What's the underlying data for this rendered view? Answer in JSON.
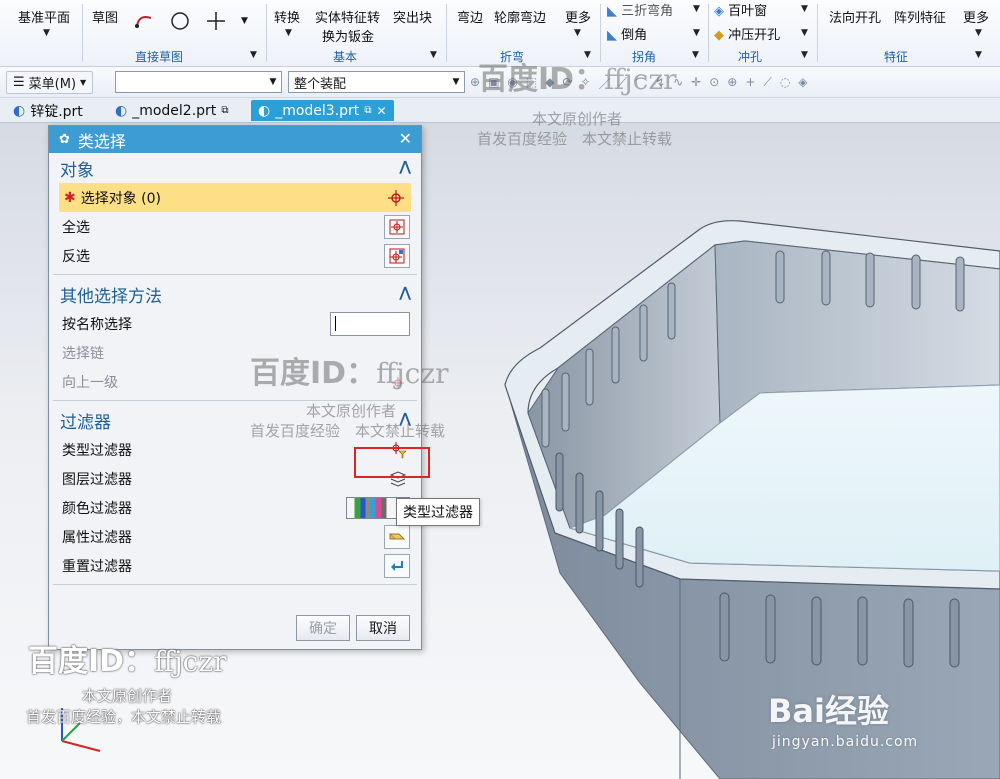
{
  "ribbon": {
    "datum_plane": "基准平面",
    "sketch": "草图",
    "convert": "转换",
    "solid_to_sheet_line1": "实体特征转",
    "solid_to_sheet_line2": "换为钣金",
    "protrude": "突出块",
    "flange": "弯边",
    "contour_flange": "轮廓弯边",
    "more1": "更多",
    "tri_bend": "三折弯角",
    "chamfer": "倒角",
    "louver": "百叶窗",
    "punch_cutout": "冲压开孔",
    "normal_cutout": "法向开孔",
    "pattern_feature": "阵列特征",
    "more2": "更多",
    "groups": {
      "direct_sketch": "直接草图",
      "basic": "基本",
      "bend": "折弯",
      "corner": "拐角",
      "punch": "冲孔",
      "feature": "特征"
    }
  },
  "toolbar": {
    "menu_label": "菜单(M)",
    "filter_combo_value": "",
    "scope_combo_value": "整个装配"
  },
  "tabs": [
    {
      "label": "锌锭.prt"
    },
    {
      "label": "_model2.prt"
    },
    {
      "label": "_model3.prt"
    }
  ],
  "dialog": {
    "title": "类选择",
    "sections": {
      "object": {
        "title": "对象",
        "select_object": "选择对象 (0)",
        "select_all": "全选",
        "invert": "反选"
      },
      "other": {
        "title": "其他选择方法",
        "by_name": "按名称选择",
        "name_value": "",
        "chain": "选择链",
        "up_level": "向上一级"
      },
      "filter": {
        "title": "过滤器",
        "type_filter": "类型过滤器",
        "layer_filter": "图层过滤器",
        "color_filter": "颜色过滤器",
        "attribute_filter": "属性过滤器",
        "reset_filter": "重置过滤器"
      }
    },
    "ok": "确定",
    "cancel": "取消"
  },
  "tooltip": "类型过滤器",
  "watermark": {
    "brand": "百度ID：",
    "id": "ffjczr",
    "line1": "本文原创作者",
    "line2": "首发百度经验　本文禁止转载",
    "line2b": "首发百度经验，本文禁止转载",
    "site_logo": "Bai经验",
    "site_url": "jingyan.baidu.com"
  },
  "colors": {
    "accent": "#3e9cd4",
    "highlight_row": "#fde086",
    "red_marker": "#e02424",
    "section_title": "#1f5f98"
  }
}
